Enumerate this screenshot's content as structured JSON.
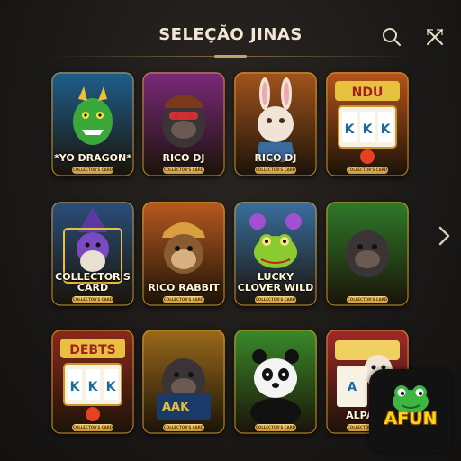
{
  "header": {
    "title": "SELEÇÃO JINAS",
    "search_icon": "search-icon",
    "close_icon": "close-icon"
  },
  "cards": [
    {
      "name": "*YO DRAGON*",
      "tag": "COLLECTOR'S CARD",
      "theme": "dragon",
      "bg": "#1f5f8c"
    },
    {
      "name": "RICO DJ",
      "tag": "COLLECTOR'S CARD",
      "theme": "gorilla-dj",
      "bg": "#7a2a7a"
    },
    {
      "name": "RICO DJ",
      "tag": "COLLECTOR'S CARD",
      "theme": "rabbit",
      "bg": "#a3541d"
    },
    {
      "name": "",
      "tag": "COLLECTOR'S CARD",
      "theme": "slot-ndi",
      "bg": "#b5541a"
    },
    {
      "name": "COLLECTOR'S CARD",
      "tag": "COLLECTOR'S CARD",
      "theme": "wizard",
      "bg": "#2a4f7a"
    },
    {
      "name": "RICO RABBIT",
      "tag": "COLLECTOR'S CARD",
      "theme": "monkey",
      "bg": "#b85a1e"
    },
    {
      "name": "LUCKY CLOVER WILD",
      "tag": "COLLECTOR'S CARD",
      "theme": "frog",
      "bg": "#3a6fa0"
    },
    {
      "name": "",
      "tag": "COLLECTOR'S CARD",
      "theme": "gorilla",
      "bg": "#2f7a2a"
    },
    {
      "name": "",
      "tag": "COLLECTOR'S CARD",
      "theme": "slot-debts",
      "bg": "#8a2a1a"
    },
    {
      "name": "",
      "tag": "COLLECTOR'S CARD",
      "theme": "gorilla-slot",
      "bg": "#9a6a1a"
    },
    {
      "name": "",
      "tag": "COLLECTOR'S CARD",
      "theme": "panda",
      "bg": "#3a8a2a"
    },
    {
      "name": "ALPACA",
      "tag": "COLLECTOR'S CARD",
      "theme": "alpaca",
      "bg": "#a02a2a"
    }
  ],
  "navigation": {
    "next_icon": "chevron-right-icon"
  },
  "brand": {
    "logo_text": "AFUN",
    "accent": "#ffd21c"
  },
  "colors": {
    "title": "#f2e7d3",
    "gold": "#c7a163",
    "background": "#1b1917"
  }
}
